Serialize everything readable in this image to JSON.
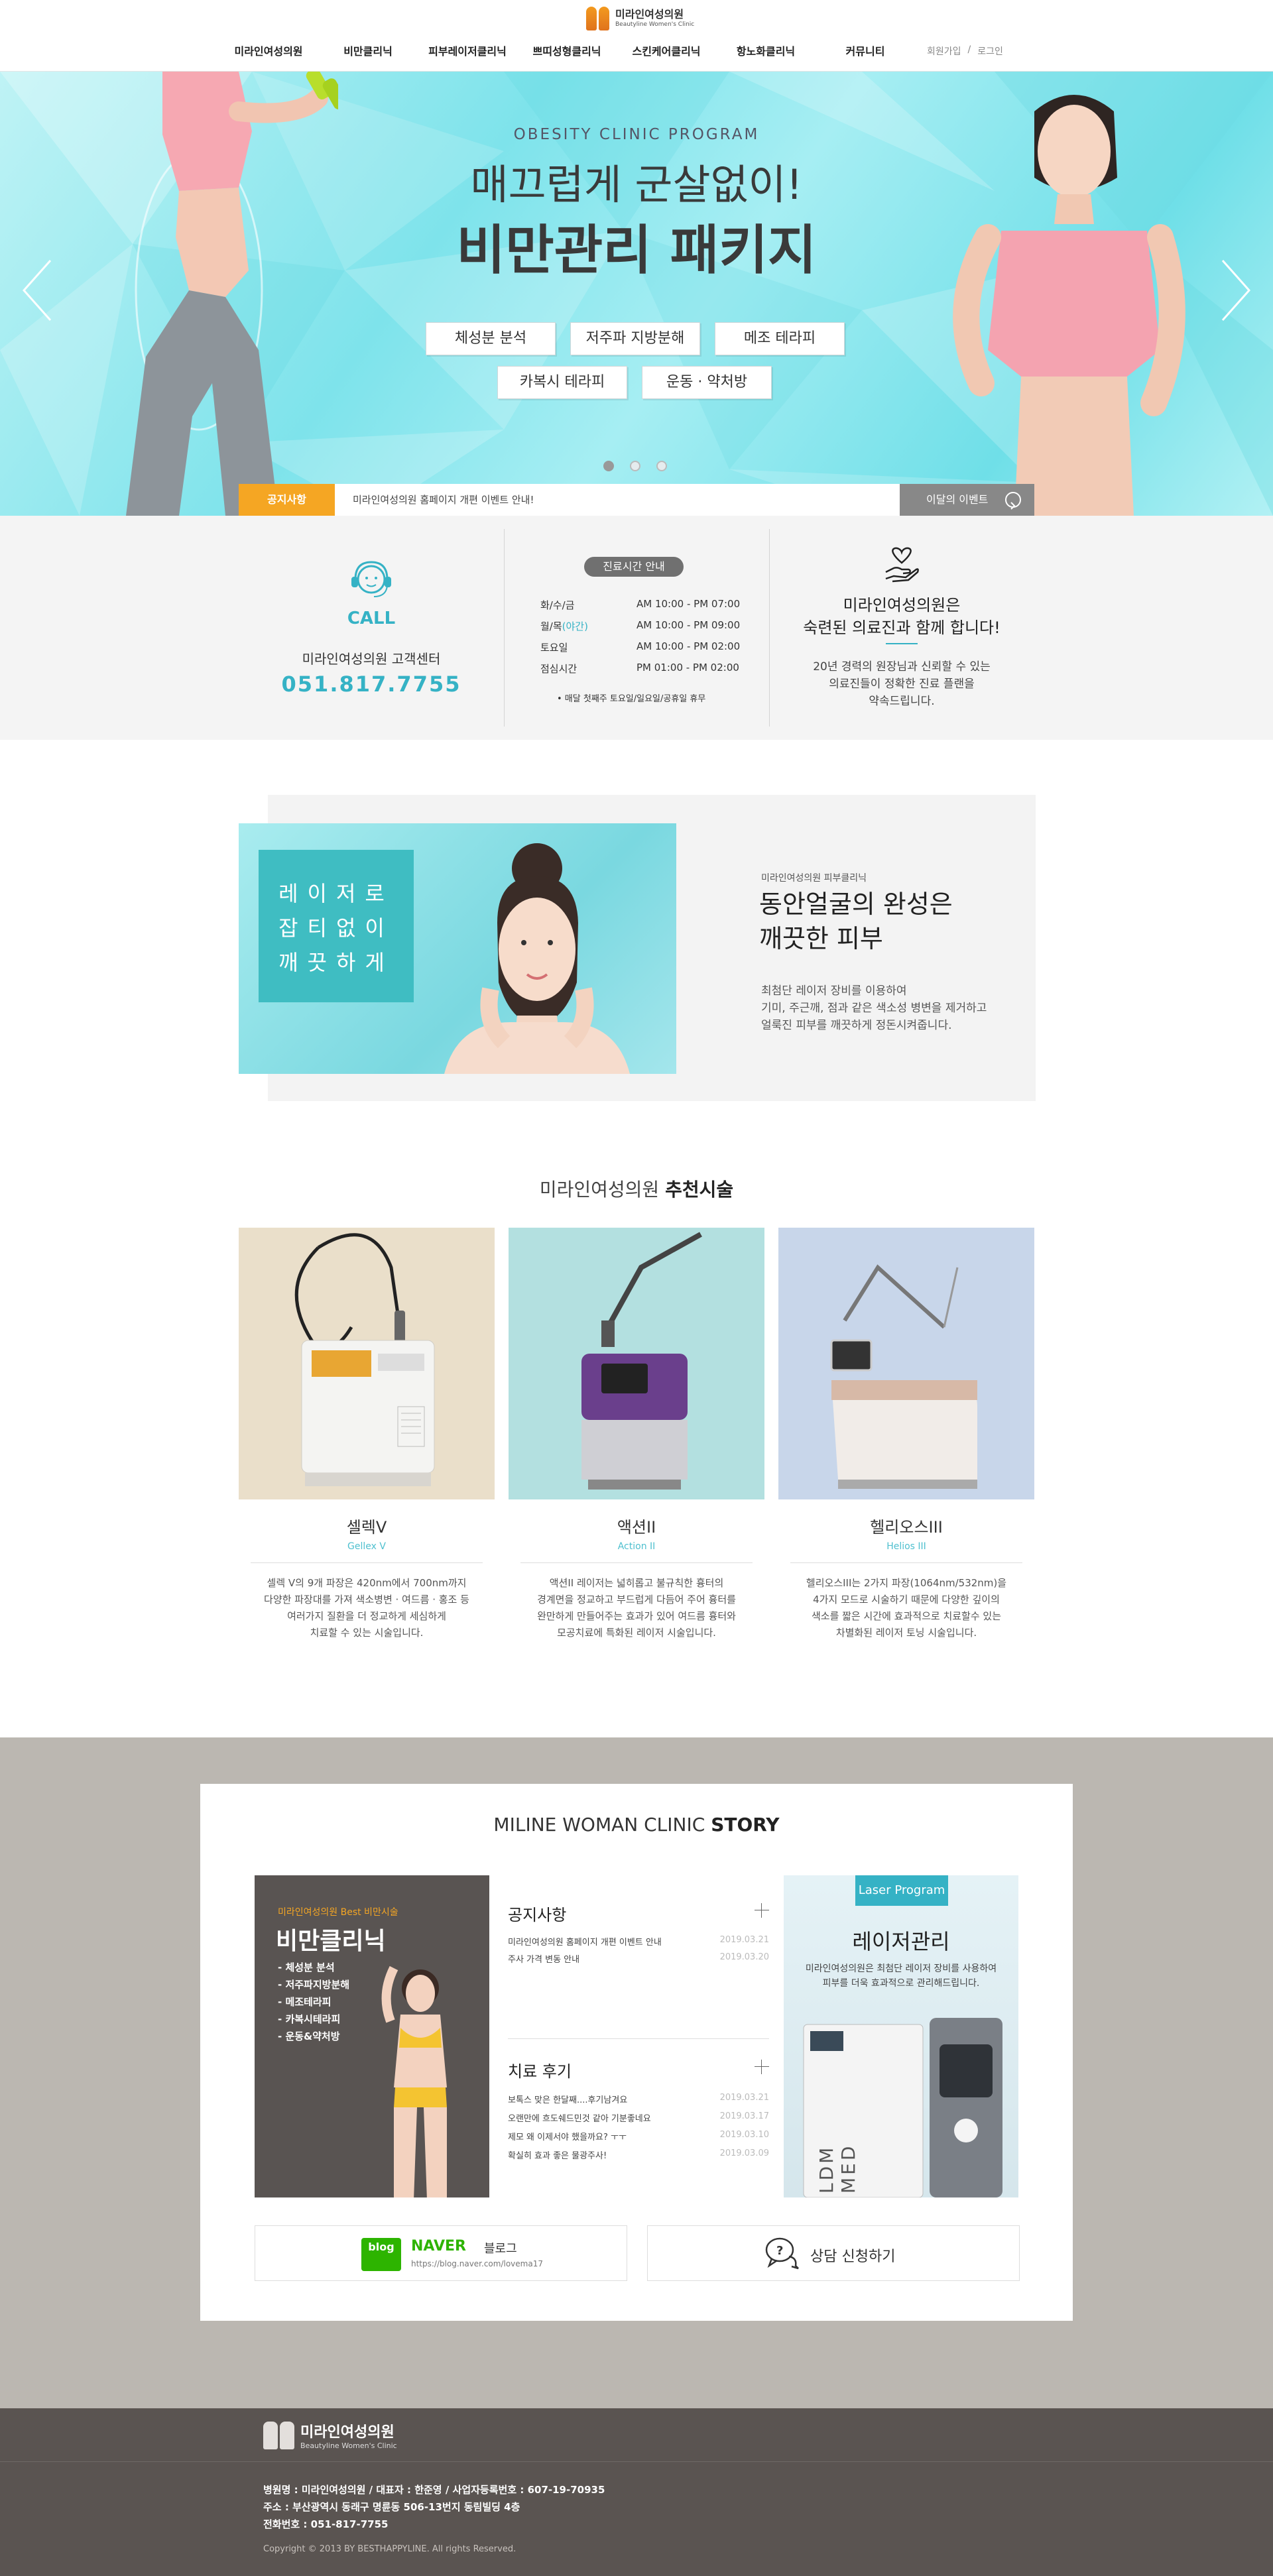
{
  "header": {
    "logo_name": "미라인여성의원",
    "logo_sub": "Beautyline Women's Clinic",
    "nav": [
      "미라인여성의원",
      "비만클리닉",
      "피부레이저클리닉",
      "쁘띠성형클리닉",
      "스킨케어클리닉",
      "항노화클리닉",
      "커뮤니티"
    ],
    "join": "회원가입",
    "separator": "/",
    "login": "로그인"
  },
  "hero": {
    "eyebrow": "OBESITY CLINIC PROGRAM",
    "line1": "매끄럽게 군살없이!",
    "line2": "비만관리 패키지",
    "buttons": [
      "체성분 분석",
      "저주파 지방분해",
      "메조 테라피",
      "카복시 테라피",
      "운동 · 약처방"
    ],
    "slide_count": 3,
    "active_slide": 1
  },
  "notice": {
    "label": "공지사항",
    "text": "미라인여성의원 홈페이지 개편 이벤트 안내!",
    "event_button": "이달의 이벤트"
  },
  "info": {
    "call_word": "CALL",
    "call_desc": "미라인여성의원 고객센터",
    "call_number": "051.817.7755",
    "hours_badge": "진료시간 안내",
    "hours": [
      {
        "day": "화/수/금",
        "day_hl": "",
        "time": "AM 10:00 - PM 07:00"
      },
      {
        "day": "월/목",
        "day_hl": "(야간)",
        "time": "AM 10:00 - PM 09:00"
      },
      {
        "day": "토요일",
        "day_hl": "",
        "time": "AM 10:00 - PM 02:00"
      },
      {
        "day": "점심시간",
        "day_hl": "",
        "time": "PM 01:00 - PM 02:00"
      }
    ],
    "hours_note": "• 매달 첫째주 토요일/일요일/공휴일 휴무",
    "intro_title_1": "미라인여성의원은",
    "intro_title_2": "숙련된 의료진과 함께 합니다!",
    "intro_desc_1": "20년 경력의 원장님과 신뢰할 수 있는",
    "intro_desc_2": "의료진들이 정확한 진료 플랜을",
    "intro_desc_3": "약속드립니다."
  },
  "feature": {
    "box_1": "레이저로",
    "box_2": "잡티없이",
    "box_3": "깨끗하게",
    "small": "미라인여성의원 피부클리닉",
    "title_1": "동안얼굴의 완성은",
    "title_2": "깨끗한 피부",
    "desc_1": "최첨단 레이저 장비를 이용하여",
    "desc_2": "기미, 주근깨, 점과 같은 색소성 병변을 제거하고",
    "desc_3": "얼룩진 피부를 깨끗하게 정돈시켜줍니다."
  },
  "recommend": {
    "title_light": "미라인여성의원",
    "title_bold": "추천시술",
    "items": [
      {
        "name": "셀렉V",
        "en": "Gellex V",
        "d1": "셀렉 V의 9개 파장은 420nm에서 700nm까지",
        "d2": "다양한 파장대를 가져 색소병변 · 여드름 · 홍조 등",
        "d3": "여러가지 질환을 더 정교하게 세심하게",
        "d4": "치료할 수 있는 시술입니다."
      },
      {
        "name": "액션II",
        "en": "Action II",
        "d1": "액션II 레이저는 넓히롭고 불규칙한 흉터의",
        "d2": "경계면을 정교하고 부드럽게 다듬어 주어 흉터를",
        "d3": "완만하게 만들어주는 효과가 있어 여드름 흉터와",
        "d4": "모공치료에 특화된 레이저 시술입니다."
      },
      {
        "name": "헬리오스III",
        "en": "Helios III",
        "d1": "헬리오스III는 2가지 파장(1064nm/532nm)을",
        "d2": "4가지 모드로 시술하기 때문에 다양한 깊이의",
        "d3": "색소를 짧은 시간에 효과적으로 치료할수 있는",
        "d4": "차별화된 레이저 토닝 시술입니다."
      }
    ]
  },
  "story": {
    "title_light": "MILINE WOMAN CLINIC",
    "title_bold": "STORY",
    "diet_small": "미라인여성의원 Best 비만시술",
    "diet_big": "비만클리닉",
    "diet_items": [
      "- 체성분 분석",
      "- 저주파지방분해",
      "- 메조테라피",
      "- 카복시테라피",
      "- 운동&약처방"
    ],
    "notice_head": "공지사항",
    "notices": [
      {
        "title": "미라인여성의원 홈페이지 개편 이벤트 안내",
        "date": "2019.03.21"
      },
      {
        "title": "주사 가격 변동 안내",
        "date": "2019.03.20"
      }
    ],
    "review_head": "치료 후기",
    "reviews": [
      {
        "title": "보톡스 맞은 한달째....후기남겨요",
        "date": "2019.03.21"
      },
      {
        "title": "오랜만에 흐도쉐드민것 같아 기분좋네요",
        "date": "2019.03.17"
      },
      {
        "title": "제모 왜 이제서야 했을까요? ㅜㅜ",
        "date": "2019.03.10"
      },
      {
        "title": "확실히 효과 좋은 물광주사!",
        "date": "2019.03.09"
      }
    ],
    "laser_tag": "Laser Program",
    "laser_title": "레이저관리",
    "laser_desc_1": "미라인여성의원은 최첨단 레이저 장비를 사용하여",
    "laser_desc_2": "피부를 더욱 효과적으로 관리해드립니다.",
    "device_text": "LDM MED",
    "blog_badge": "blog",
    "naver": "NAVER",
    "blog_label": "블로그",
    "blog_url": "https://blog.naver.com/lovema17",
    "consult": "상담 신청하기"
  },
  "footer": {
    "logo_name": "미라인여성의원",
    "logo_sub": "Beautyline Women's Clinic",
    "line1": "병원명 : 미라인여성의원  /  대표자 : 한준영  /  사업자등록번호 : 607-19-70935",
    "line2": "주소 : 부산광역시 동래구 명륜동 506-13번지 동림빌딩 4층",
    "line3": "전화번호 : 051-817-7755",
    "copyright": "Copyright © 2013 BY BESTHAPPYLINE. All rights Reserved."
  },
  "colors": {
    "accent": "#35b2c5",
    "orange": "#f5a623",
    "story_bg": "#bbb7b1",
    "footer_bg": "#5a5451"
  }
}
